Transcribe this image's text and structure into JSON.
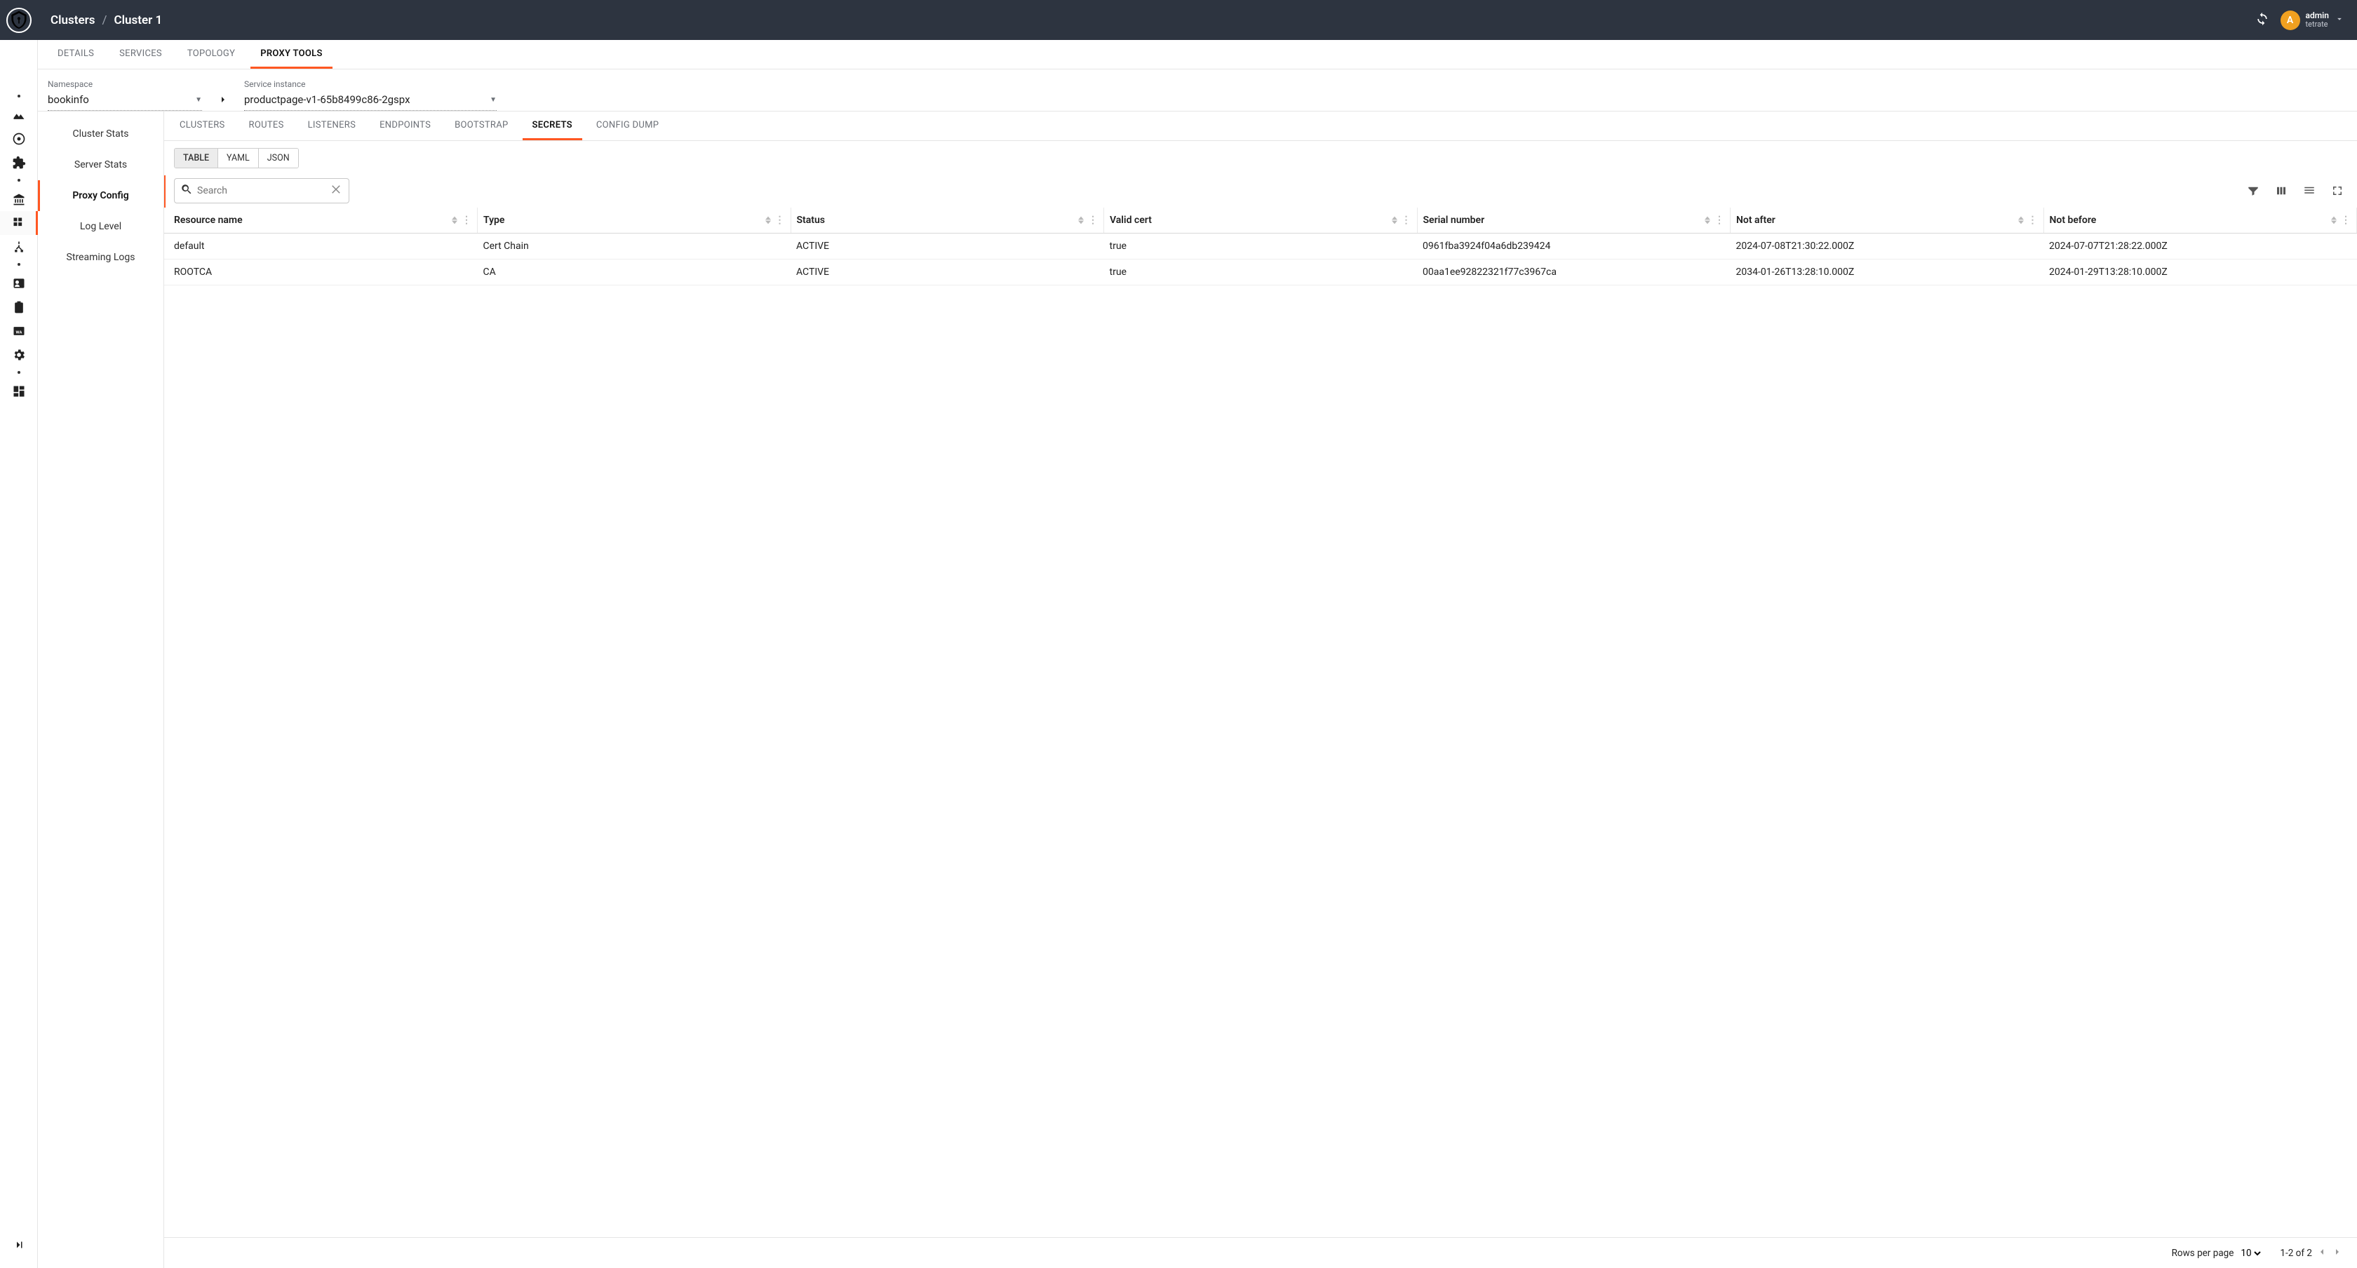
{
  "breadcrumb": {
    "root": "Clusters",
    "current": "Cluster 1"
  },
  "user": {
    "initial": "A",
    "name": "admin",
    "org": "tetrate"
  },
  "primary_tabs": {
    "items": [
      "DETAILS",
      "SERVICES",
      "TOPOLOGY",
      "PROXY TOOLS"
    ],
    "active_index": 3
  },
  "selectors": {
    "namespace": {
      "label": "Namespace",
      "value": "bookinfo"
    },
    "service_instance": {
      "label": "Service instance",
      "value": "productpage-v1-65b8499c86-2gspx"
    }
  },
  "subnav": {
    "items": [
      "Cluster Stats",
      "Server Stats",
      "Proxy Config",
      "Log Level",
      "Streaming Logs"
    ],
    "active_index": 2
  },
  "secondary_tabs": {
    "items": [
      "CLUSTERS",
      "ROUTES",
      "LISTENERS",
      "ENDPOINTS",
      "BOOTSTRAP",
      "SECRETS",
      "CONFIG DUMP"
    ],
    "active_index": 5
  },
  "view_toggle": {
    "items": [
      "TABLE",
      "YAML",
      "JSON"
    ],
    "active_index": 0
  },
  "search": {
    "placeholder": "Search",
    "value": ""
  },
  "table": {
    "columns": [
      "Resource name",
      "Type",
      "Status",
      "Valid cert",
      "Serial number",
      "Not after",
      "Not before"
    ],
    "rows": [
      {
        "resource_name": "default",
        "type": "Cert Chain",
        "status": "ACTIVE",
        "valid_cert": "true",
        "serial_number": "0961fba3924f04a6db239424",
        "not_after": "2024-07-08T21:30:22.000Z",
        "not_before": "2024-07-07T21:28:22.000Z"
      },
      {
        "resource_name": "ROOTCA",
        "type": "CA",
        "status": "ACTIVE",
        "valid_cert": "true",
        "serial_number": "00aa1ee92822321f77c3967ca",
        "not_after": "2034-01-26T13:28:10.000Z",
        "not_before": "2024-01-29T13:28:10.000Z"
      }
    ]
  },
  "pagination": {
    "rows_per_page_label": "Rows per page",
    "rows_per_page_value": "10",
    "range": "1-2 of 2"
  }
}
